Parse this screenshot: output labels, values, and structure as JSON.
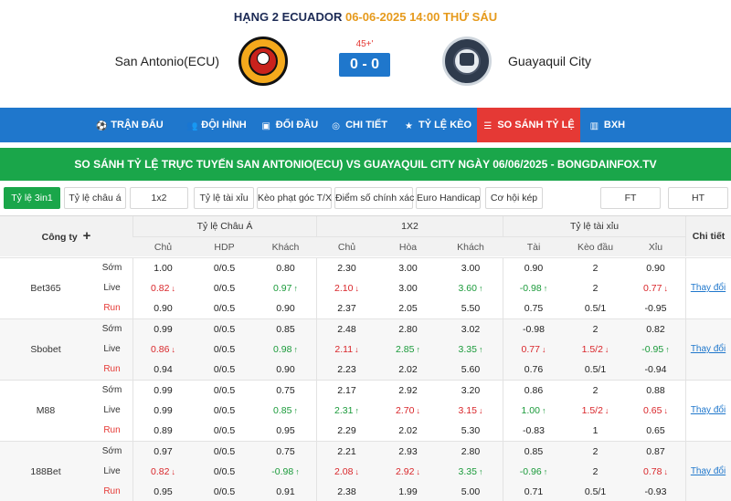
{
  "header": {
    "league": "HẠNG 2 ECUADOR",
    "datetime": "06-06-2025 14:00 THỨ SÁU",
    "home_team": "San Antonio(ECU)",
    "away_team": "Guayaquil City",
    "minute": "45+'",
    "score": "0 - 0"
  },
  "nav": {
    "items": [
      {
        "label": "TRẬN ĐẤU",
        "icon": "soccer-ball-icon"
      },
      {
        "label": "ĐỘI HÌNH",
        "icon": "team-icon"
      },
      {
        "label": "ĐỐI ĐẦU",
        "icon": "head-to-head-icon"
      },
      {
        "label": "CHI TIẾT",
        "icon": "details-icon"
      },
      {
        "label": "TỶ LỆ KÈO",
        "icon": "star-icon"
      },
      {
        "label": "SO SÁNH TỶ LỆ",
        "icon": "compare-icon",
        "active": true
      },
      {
        "label": "BXH",
        "icon": "bar-chart-icon"
      }
    ]
  },
  "banner": "SO SÁNH TỶ LỆ TRỰC TUYẾN SAN ANTONIO(ECU) VS GUAYAQUIL CITY NGÀY 06/06/2025 - BONGDAINFOX.TV",
  "filters": {
    "items": [
      "Tỷ lệ 3in1",
      "Tỷ lệ châu á",
      "1x2",
      "Tỷ lệ tài xỉu",
      "Kèo phạt góc T/X",
      "Điểm số chính xác",
      "Euro Handicap",
      "Cơ hội kép"
    ],
    "ft": "FT",
    "ht": "HT"
  },
  "table": {
    "company_header": "Công ty",
    "detail_header": "Chi tiết",
    "groups": [
      "Tỷ lệ Châu Á",
      "1X2",
      "Tỷ lệ tài xỉu"
    ],
    "subheaders": [
      "Chủ",
      "HDP",
      "Khách",
      "Chủ",
      "Hòa",
      "Khách",
      "Tài",
      "Kèo đầu",
      "Xỉu"
    ],
    "row_labels": [
      "Sớm",
      "Live",
      "Run"
    ],
    "change_label": "Thay đổi",
    "companies": [
      {
        "name": "Bet365",
        "rows": [
          [
            {
              "v": "1.00"
            },
            {
              "v": "0/0.5"
            },
            {
              "v": "0.80"
            },
            {
              "v": "2.30"
            },
            {
              "v": "3.00"
            },
            {
              "v": "3.00"
            },
            {
              "v": "0.90"
            },
            {
              "v": "2"
            },
            {
              "v": "0.90"
            }
          ],
          [
            {
              "v": "0.82",
              "t": "down"
            },
            {
              "v": "0/0.5"
            },
            {
              "v": "0.97",
              "t": "up"
            },
            {
              "v": "2.10",
              "t": "down"
            },
            {
              "v": "3.00"
            },
            {
              "v": "3.60",
              "t": "up"
            },
            {
              "v": "-0.98",
              "t": "up"
            },
            {
              "v": "2"
            },
            {
              "v": "0.77",
              "t": "down"
            }
          ],
          [
            {
              "v": "0.90"
            },
            {
              "v": "0/0.5"
            },
            {
              "v": "0.90"
            },
            {
              "v": "2.37"
            },
            {
              "v": "2.05"
            },
            {
              "v": "5.50"
            },
            {
              "v": "0.75"
            },
            {
              "v": "0.5/1"
            },
            {
              "v": "-0.95"
            }
          ]
        ]
      },
      {
        "name": "Sbobet",
        "rows": [
          [
            {
              "v": "0.99"
            },
            {
              "v": "0/0.5"
            },
            {
              "v": "0.85"
            },
            {
              "v": "2.48"
            },
            {
              "v": "2.80"
            },
            {
              "v": "3.02"
            },
            {
              "v": "-0.98"
            },
            {
              "v": "2"
            },
            {
              "v": "0.82"
            }
          ],
          [
            {
              "v": "0.86",
              "t": "down"
            },
            {
              "v": "0/0.5"
            },
            {
              "v": "0.98",
              "t": "up"
            },
            {
              "v": "2.11",
              "t": "down"
            },
            {
              "v": "2.85",
              "t": "up"
            },
            {
              "v": "3.35",
              "t": "up"
            },
            {
              "v": "0.77",
              "t": "down"
            },
            {
              "v": "1.5/2",
              "t": "down"
            },
            {
              "v": "-0.95",
              "t": "up"
            }
          ],
          [
            {
              "v": "0.94"
            },
            {
              "v": "0/0.5"
            },
            {
              "v": "0.90"
            },
            {
              "v": "2.23"
            },
            {
              "v": "2.02"
            },
            {
              "v": "5.60"
            },
            {
              "v": "0.76"
            },
            {
              "v": "0.5/1"
            },
            {
              "v": "-0.94"
            }
          ]
        ]
      },
      {
        "name": "M88",
        "rows": [
          [
            {
              "v": "0.99"
            },
            {
              "v": "0/0.5"
            },
            {
              "v": "0.75"
            },
            {
              "v": "2.17"
            },
            {
              "v": "2.92"
            },
            {
              "v": "3.20"
            },
            {
              "v": "0.86"
            },
            {
              "v": "2"
            },
            {
              "v": "0.88"
            }
          ],
          [
            {
              "v": "0.99"
            },
            {
              "v": "0/0.5"
            },
            {
              "v": "0.85",
              "t": "up"
            },
            {
              "v": "2.31",
              "t": "up"
            },
            {
              "v": "2.70",
              "t": "down"
            },
            {
              "v": "3.15",
              "t": "down"
            },
            {
              "v": "1.00",
              "t": "up"
            },
            {
              "v": "1.5/2",
              "t": "down"
            },
            {
              "v": "0.65",
              "t": "down"
            }
          ],
          [
            {
              "v": "0.89"
            },
            {
              "v": "0/0.5"
            },
            {
              "v": "0.95"
            },
            {
              "v": "2.29"
            },
            {
              "v": "2.02"
            },
            {
              "v": "5.30"
            },
            {
              "v": "-0.83"
            },
            {
              "v": "1"
            },
            {
              "v": "0.65"
            }
          ]
        ]
      },
      {
        "name": "188Bet",
        "rows": [
          [
            {
              "v": "0.97"
            },
            {
              "v": "0/0.5"
            },
            {
              "v": "0.75"
            },
            {
              "v": "2.21"
            },
            {
              "v": "2.93"
            },
            {
              "v": "2.80"
            },
            {
              "v": "0.85"
            },
            {
              "v": "2"
            },
            {
              "v": "0.87"
            }
          ],
          [
            {
              "v": "0.82",
              "t": "down"
            },
            {
              "v": "0/0.5"
            },
            {
              "v": "-0.98",
              "t": "up"
            },
            {
              "v": "2.08",
              "t": "down"
            },
            {
              "v": "2.92",
              "t": "down"
            },
            {
              "v": "3.35",
              "t": "up"
            },
            {
              "v": "-0.96",
              "t": "up"
            },
            {
              "v": "2"
            },
            {
              "v": "0.78",
              "t": "down"
            }
          ],
          [
            {
              "v": "0.95"
            },
            {
              "v": "0/0.5"
            },
            {
              "v": "0.91"
            },
            {
              "v": "2.38"
            },
            {
              "v": "1.99"
            },
            {
              "v": "5.00"
            },
            {
              "v": "0.71"
            },
            {
              "v": "0.5/1"
            },
            {
              "v": "-0.93"
            }
          ]
        ]
      }
    ]
  },
  "colors": {
    "nav_blue": "#1f77cc",
    "active_red": "#e53935",
    "banner_green": "#1aa64a",
    "up": "#1a9a3a",
    "down": "#d9262a",
    "datetime_orange": "#e69a1c"
  }
}
